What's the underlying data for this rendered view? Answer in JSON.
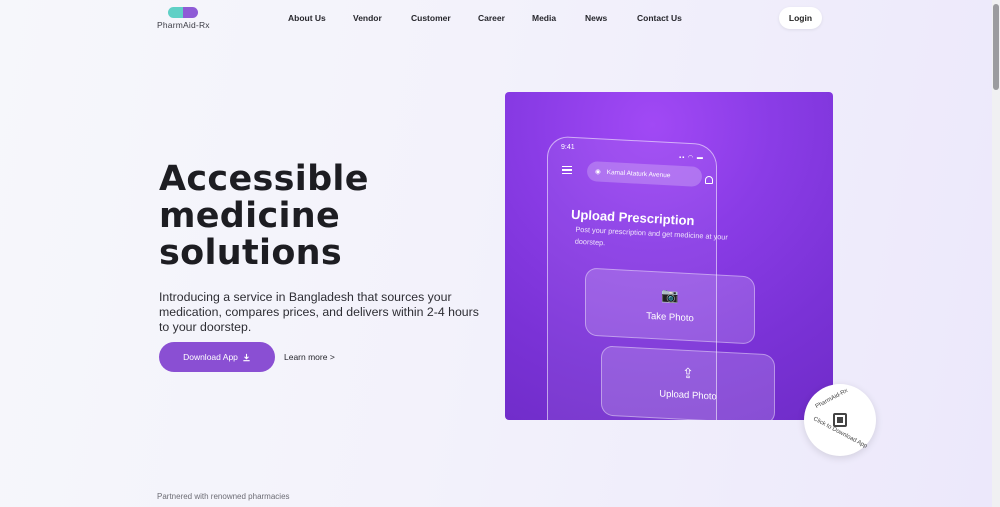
{
  "brand": {
    "name": "PharmAid-Rx"
  },
  "nav": {
    "links": [
      "About Us",
      "Vendor",
      "Customer",
      "Career",
      "Media",
      "News",
      "Contact Us"
    ],
    "login": "Login"
  },
  "hero": {
    "title_lines": [
      "Accessible",
      "medicine",
      "solutions"
    ],
    "description": "Introducing a service in Bangladesh that sources your medication, compares prices, and delivers within 2-4 hours to your doorstep.",
    "download_label": "Download App",
    "download_icon": "download-icon",
    "learn_more": "Learn more >"
  },
  "phone": {
    "time": "9:41",
    "location": "Kamal Ataturk Avenue",
    "heading": "Upload Prescription",
    "subtext": "Post your prescription and get medicine at your doorstep.",
    "take_photo": "Take Photo",
    "upload_photo": "Upload Photo"
  },
  "badge": {
    "top_text": "PharmAid-Rx",
    "bottom_text": "Click to Download App"
  },
  "partnered": "Partnered with renowned pharmacies",
  "colors": {
    "accent": "#8a4fd3",
    "visual_bg": "#7a32d6",
    "logo_teal": "#5fd0c6"
  }
}
